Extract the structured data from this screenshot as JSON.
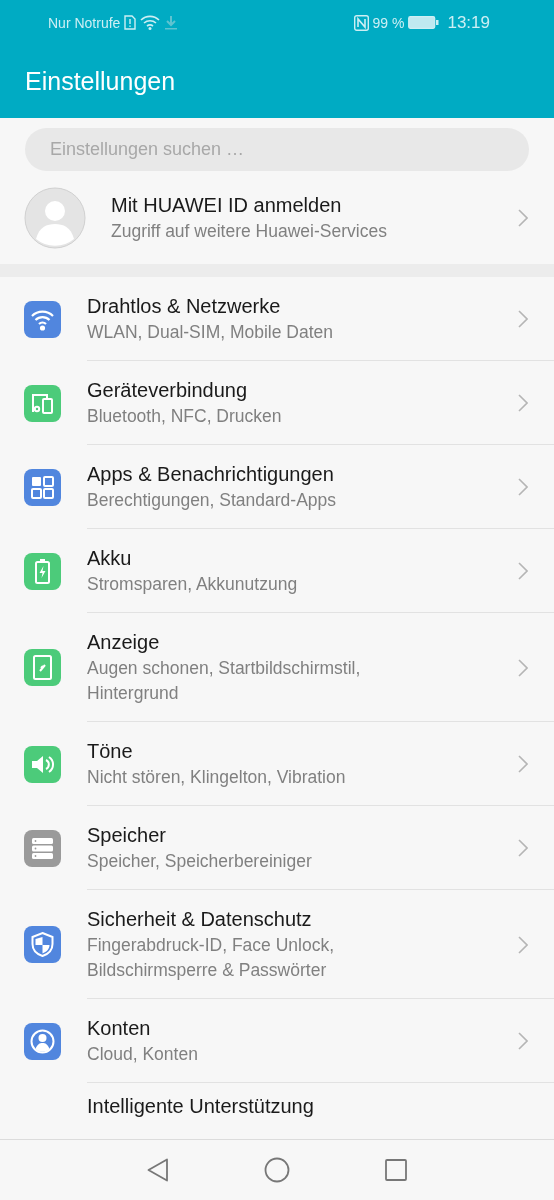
{
  "status_bar": {
    "carrier": "Nur Notrufe",
    "battery": "99 %",
    "time": "13:19"
  },
  "header": {
    "title": "Einstellungen"
  },
  "search": {
    "placeholder": "Einstellungen suchen …"
  },
  "account": {
    "title": "Mit HUAWEI ID anmelden",
    "subtitle": "Zugriff auf weitere Huawei-Services"
  },
  "items": [
    {
      "title": "Drahtlos & Netzwerke",
      "subtitle": "WLAN, Dual-SIM, Mobile Daten",
      "color": "#5186de"
    },
    {
      "title": "Geräteverbindung",
      "subtitle": "Bluetooth, NFC, Drucken",
      "color": "#4ccb7a"
    },
    {
      "title": "Apps & Benachrichtigungen",
      "subtitle": "Berechtigungen, Standard-Apps",
      "color": "#5186de"
    },
    {
      "title": "Akku",
      "subtitle": "Stromsparen, Akkunutzung",
      "color": "#4ccb7a"
    },
    {
      "title": "Anzeige",
      "subtitle": "Augen schonen, Startbildschirmstil, Hintergrund",
      "color": "#4ccb7a"
    },
    {
      "title": "Töne",
      "subtitle": "Nicht stören, Klingelton, Vibration",
      "color": "#4ccb7a"
    },
    {
      "title": "Speicher",
      "subtitle": "Speicher, Speicherbereiniger",
      "color": "#9a9a9a"
    },
    {
      "title": "Sicherheit & Datenschutz",
      "subtitle": "Fingerabdruck-ID, Face Unlock, Bildschirmsperre & Passwörter",
      "color": "#5186de"
    },
    {
      "title": "Konten",
      "subtitle": "Cloud, Konten",
      "color": "#5186de"
    },
    {
      "title": "Intelligente Unterstützung"
    }
  ]
}
